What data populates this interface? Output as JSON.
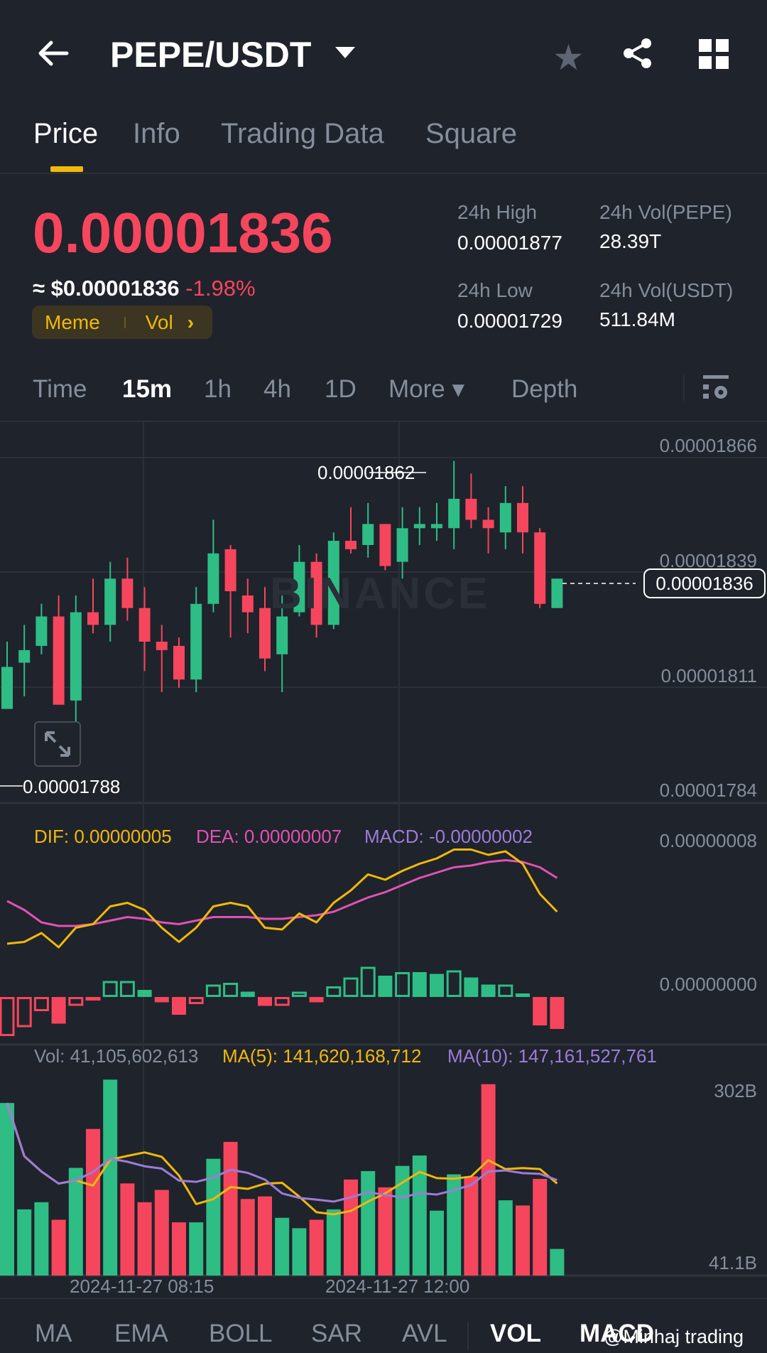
{
  "header": {
    "title": "PEPE/USDT",
    "back_icon": "arrow-left-icon",
    "fav_icon": "star-icon",
    "share_icon": "share-icon",
    "grid_icon": "grid-icon"
  },
  "tabs": [
    {
      "label": "Price"
    },
    {
      "label": "Info"
    },
    {
      "label": "Trading Data"
    },
    {
      "label": "Square"
    }
  ],
  "ticker": {
    "last": "0.00001836",
    "usd": "≈ $0.00001836",
    "change": "-1.98%",
    "tag1": "Meme",
    "tag2": "Vol",
    "tag_arrow": "›",
    "high_label": "24h High",
    "high": "0.00001877",
    "low_label": "24h Low",
    "low": "0.00001729",
    "volb_label": "24h Vol(PEPE)",
    "volb": "28.39T",
    "volq_label": "24h Vol(USDT)",
    "volq": "511.84M"
  },
  "timeframes": [
    {
      "label": "Time"
    },
    {
      "label": "15m"
    },
    {
      "label": "1h"
    },
    {
      "label": "4h"
    },
    {
      "label": "1D"
    },
    {
      "label": "More ▾"
    },
    {
      "label": "Depth"
    }
  ],
  "colors": {
    "up": "#2ebd85",
    "down": "#f6465d",
    "dif": "#f0b90b",
    "dea": "#e052b4",
    "macd": "#9c7cd8",
    "accent": "#f0b90b"
  },
  "chart": {
    "price_axis": [
      "0.00001866",
      "0.00001839",
      "0.00001811",
      "0.00001784"
    ],
    "max_label": "0.00001862",
    "min_label": "0.00001788",
    "current_label": "0.00001836",
    "watermark": "BINANCE",
    "candles_1e8": [
      [
        1803,
        1813,
        1819,
        1803
      ],
      [
        1814,
        1817,
        1823,
        1806
      ],
      [
        1818,
        1825,
        1828,
        1816
      ],
      [
        1825,
        1804,
        1830,
        1804
      ],
      [
        1805,
        1826,
        1830,
        1800
      ],
      [
        1826,
        1823,
        1834,
        1821
      ],
      [
        1823,
        1834,
        1838,
        1819
      ],
      [
        1834,
        1827,
        1839,
        1824
      ],
      [
        1827,
        1819,
        1832,
        1812
      ],
      [
        1819,
        1817,
        1823,
        1807
      ],
      [
        1818,
        1810,
        1820,
        1808
      ],
      [
        1810,
        1828,
        1832,
        1807
      ],
      [
        1828,
        1840,
        1848,
        1826
      ],
      [
        1841,
        1831,
        1842,
        1820
      ],
      [
        1830,
        1826,
        1834,
        1821
      ],
      [
        1827,
        1815,
        1832,
        1812
      ],
      [
        1816,
        1825,
        1830,
        1807
      ],
      [
        1826,
        1838,
        1842,
        1825
      ],
      [
        1838,
        1823,
        1840,
        1820
      ],
      [
        1823,
        1843,
        1845,
        1822
      ],
      [
        1843,
        1841,
        1851,
        1840
      ],
      [
        1842,
        1847,
        1852,
        1839
      ],
      [
        1847,
        1837,
        1847,
        1836
      ],
      [
        1838,
        1846,
        1851,
        1834
      ],
      [
        1846,
        1847,
        1851,
        1842
      ],
      [
        1846,
        1847,
        1852,
        1843
      ],
      [
        1846,
        1853,
        1862,
        1841
      ],
      [
        1853,
        1848,
        1859,
        1846
      ],
      [
        1848,
        1846,
        1851,
        1840
      ],
      [
        1845,
        1852,
        1856,
        1841
      ],
      [
        1852,
        1845,
        1856,
        1840
      ],
      [
        1845,
        1828,
        1846,
        1827
      ],
      [
        1827,
        1834,
        1834,
        1827
      ]
    ]
  },
  "macd": {
    "dif_label": "DIF: 0.00000005",
    "dea_label": "DEA: 0.00000007",
    "macd_label": "MACD: -0.00000002",
    "axis": [
      "0.00000008",
      "0.00000000"
    ],
    "dif_1e9": [
      30,
      31,
      36,
      28,
      39,
      41,
      51,
      53,
      49,
      39,
      31,
      39,
      51,
      53,
      51,
      39,
      38,
      47,
      42,
      53,
      60,
      69,
      66,
      71,
      75,
      78,
      83,
      83,
      80,
      82,
      75,
      58,
      48
    ],
    "dea_1e9": [
      54,
      49,
      42,
      40,
      40,
      41,
      43,
      45,
      44,
      42,
      41,
      43,
      45,
      45,
      45,
      44,
      44,
      45,
      46,
      48,
      52,
      56,
      59,
      63,
      67,
      70,
      73,
      74,
      76,
      77,
      76,
      73,
      67
    ],
    "hist_1e9": [
      -22,
      -17,
      -8,
      -15,
      -5,
      -2,
      9,
      9,
      4,
      -3,
      -10,
      -4,
      7,
      8,
      3,
      -5,
      -5,
      3,
      -3,
      6,
      11,
      17,
      12,
      14,
      14,
      13,
      15,
      11,
      7,
      7,
      2,
      -16,
      -18
    ],
    "hist_hollow": [
      1,
      1,
      1,
      0,
      1,
      1,
      1,
      1,
      0,
      0,
      0,
      1,
      1,
      1,
      0,
      0,
      1,
      1,
      0,
      1,
      1,
      1,
      0,
      1,
      0,
      0,
      1,
      0,
      0,
      1,
      0,
      0,
      0
    ]
  },
  "volume": {
    "vol_label": "Vol: 41,105,602,613",
    "ma5_label": "MA(5): 141,620,168,712",
    "ma10_label": "MA(10): 147,161,527,761",
    "axis": [
      "302B",
      "41.1B"
    ],
    "values_B": [
      266,
      102,
      113,
      86,
      166,
      226,
      302,
      142,
      113,
      132,
      82,
      82,
      180,
      206,
      118,
      122,
      89,
      73,
      86,
      102,
      148,
      161,
      136,
      169,
      185,
      100,
      156,
      153,
      295,
      116,
      108,
      149,
      41
    ]
  },
  "dates": [
    "2024-11-27 08:15",
    "2024-11-27 12:00"
  ],
  "indicators": [
    {
      "label": "MA"
    },
    {
      "label": "EMA"
    },
    {
      "label": "BOLL"
    },
    {
      "label": "SAR"
    },
    {
      "label": "AVL"
    },
    {
      "label": "VOL"
    },
    {
      "label": "MACD"
    }
  ],
  "watermark_user": "@Minhaj trading"
}
